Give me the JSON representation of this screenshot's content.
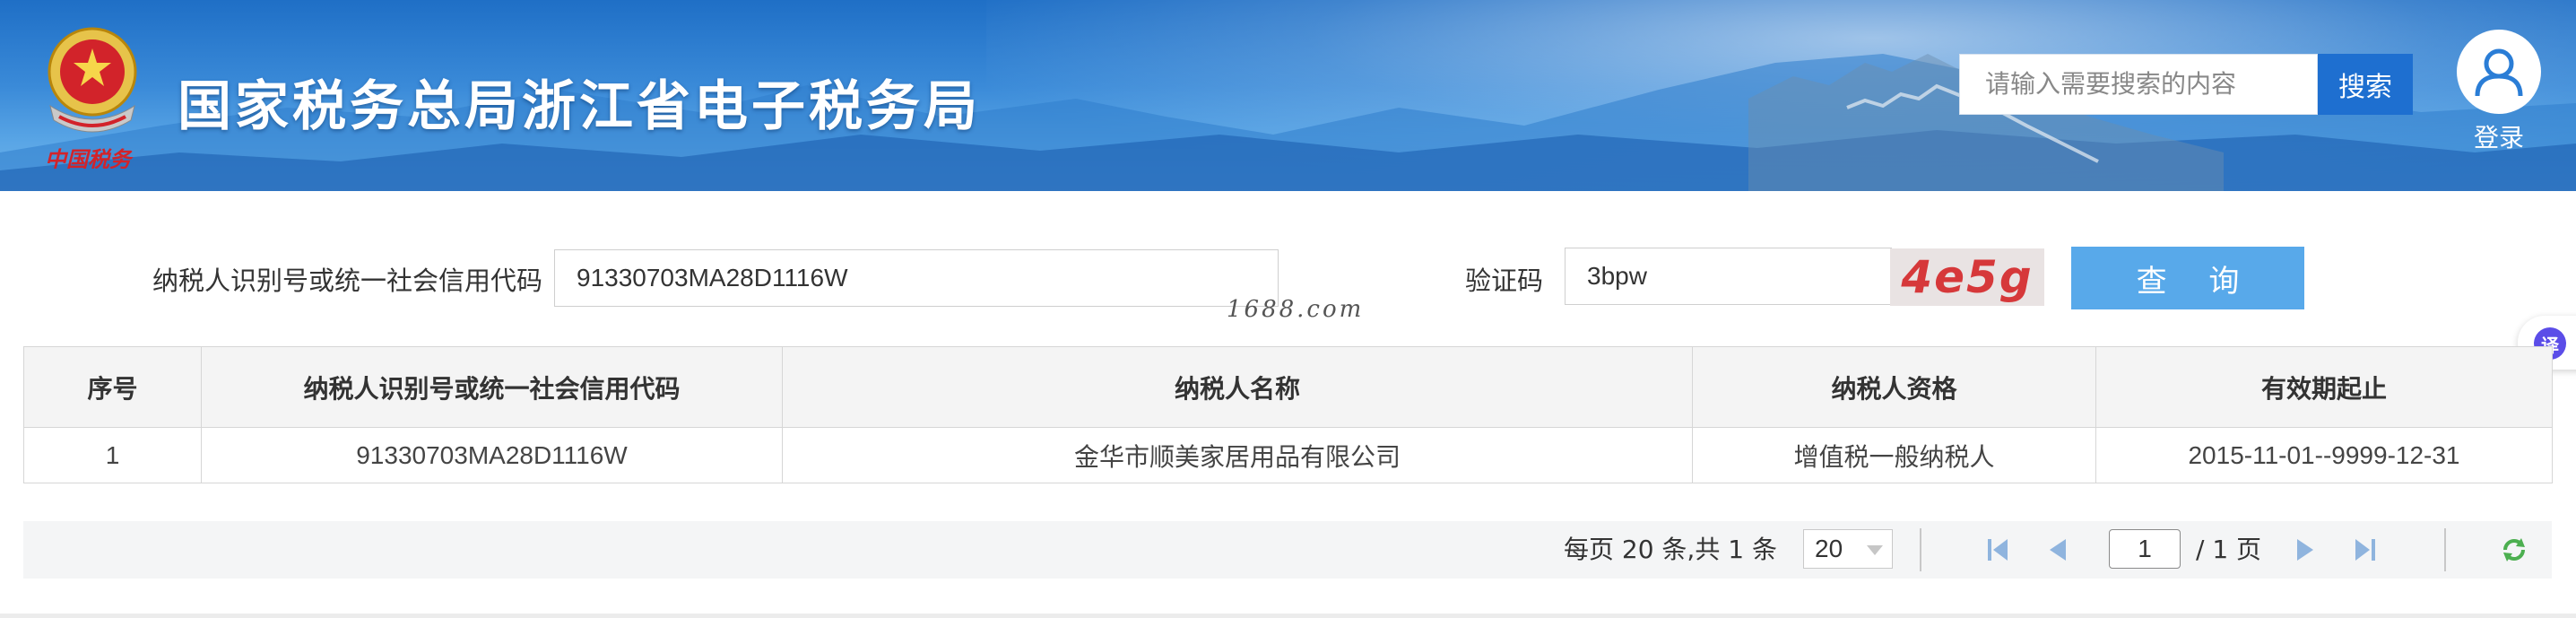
{
  "header": {
    "site_title": "国家税务总局浙江省电子税务局",
    "emblem_text": "中国税务",
    "search_placeholder": "请输入需要搜索的内容",
    "search_button": "搜索",
    "login_label": "登录"
  },
  "query_form": {
    "taxpayer_id_label": "纳税人识别号或统一社会信用代码",
    "taxpayer_id_value": "91330703MA28D1116W",
    "captcha_label": "验证码",
    "captcha_value": "3bpw",
    "captcha_image_text": "4e5g",
    "query_button": "查 询"
  },
  "watermark": "1688.com",
  "translate_icon_label": "译",
  "table": {
    "columns": [
      "序号",
      "纳税人识别号或统一社会信用代码",
      "纳税人名称",
      "纳税人资格",
      "有效期起止"
    ],
    "rows": [
      [
        "1",
        "91330703MA28D1116W",
        "金华市顺美家居用品有限公司",
        "增值税一般纳税人",
        "2015-11-01--9999-12-31"
      ]
    ]
  },
  "pager": {
    "info": "每页 20 条,共 1 条",
    "page_size": "20",
    "current_page": "1",
    "total_pages_label": "/ 1 页"
  },
  "colors": {
    "accent_blue": "#1e6fd0",
    "query_button": "#58a9ea",
    "captcha_text": "#d6383a"
  }
}
